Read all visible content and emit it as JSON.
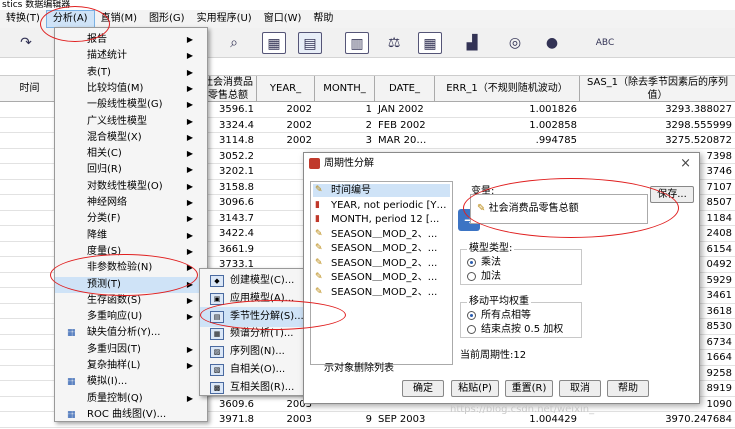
{
  "window": {
    "title": "stics 数据编辑器"
  },
  "menubar": [
    {
      "label": "转换(T)",
      "active": false
    },
    {
      "label": "分析(A)",
      "active": true
    },
    {
      "label": "直销(M)",
      "active": false
    },
    {
      "label": "图形(G)",
      "active": false
    },
    {
      "label": "实用程序(U)",
      "active": false
    },
    {
      "label": "窗口(W)",
      "active": false
    },
    {
      "label": "帮助",
      "active": false
    }
  ],
  "grid": {
    "headers": [
      "时间",
      "社会消费品零售总额",
      "YEAR_",
      "MONTH_",
      "DATE_",
      "ERR_1（不规则随机波动）",
      "SAS_1（除去季节因素后的序列值）"
    ],
    "rows": [
      [
        "",
        "3596.1",
        "2002",
        "1",
        "JAN 2002",
        "1.001826",
        "3293.388027"
      ],
      [
        "",
        "3324.4",
        "2002",
        "2",
        "FEB 2002",
        "1.002858",
        "3298.555999"
      ],
      [
        "",
        "3114.8",
        "2002",
        "3",
        "MAR 20…",
        ".994785",
        "3275.520872"
      ],
      [
        "",
        "3052.2",
        "",
        "",
        "",
        "",
        "7398"
      ],
      [
        "",
        "3202.1",
        "",
        "",
        "",
        "",
        "3746"
      ],
      [
        "",
        "3158.8",
        "",
        "",
        "",
        "",
        "7107"
      ],
      [
        "",
        "3096.6",
        "",
        "",
        "",
        "",
        "8507"
      ],
      [
        "",
        "3143.7",
        "",
        "",
        "",
        "",
        "1184"
      ],
      [
        "",
        "3422.4",
        "",
        "",
        "",
        "",
        "2408"
      ],
      [
        "",
        "3661.9",
        "",
        "",
        "",
        "",
        "6154"
      ],
      [
        "",
        "3733.1",
        "",
        "",
        "",
        "",
        "0492"
      ],
      [
        "",
        "",
        "",
        "",
        "",
        "",
        "5929"
      ],
      [
        "",
        "",
        "",
        "",
        "",
        "",
        "3461"
      ],
      [
        "",
        "",
        "",
        "",
        "",
        "",
        "3618"
      ],
      [
        "",
        "",
        "",
        "",
        "",
        "",
        "8530"
      ],
      [
        "",
        "",
        "",
        "",
        "",
        "",
        "6734"
      ],
      [
        "",
        "",
        "",
        "",
        "",
        "",
        "1664"
      ],
      [
        "",
        "",
        "",
        "",
        "",
        "",
        "9258"
      ],
      [
        "",
        "",
        "",
        "",
        "",
        "",
        "8919"
      ],
      [
        "",
        "3609.6",
        "2003",
        "",
        "",
        "",
        "1090"
      ],
      [
        "",
        "3971.8",
        "2003",
        "9",
        "SEP 2003",
        "1.004429",
        "3970.247684"
      ]
    ]
  },
  "analyze_menu": [
    {
      "label": "报告",
      "submenu": true
    },
    {
      "label": "描述统计",
      "submenu": true
    },
    {
      "label": "表(T)",
      "submenu": true
    },
    {
      "label": "比较均值(M)",
      "submenu": true
    },
    {
      "label": "一般线性模型(G)",
      "submenu": true
    },
    {
      "label": "广义线性模型",
      "submenu": true
    },
    {
      "label": "混合模型(X)",
      "submenu": true
    },
    {
      "label": "相关(C)",
      "submenu": true
    },
    {
      "label": "回归(R)",
      "submenu": true
    },
    {
      "label": "对数线性模型(O)",
      "submenu": true
    },
    {
      "label": "神经网络",
      "submenu": true
    },
    {
      "label": "分类(F)",
      "submenu": true
    },
    {
      "label": "降维",
      "submenu": true
    },
    {
      "label": "度量(S)",
      "submenu": true
    },
    {
      "label": "非参数检验(N)",
      "submenu": true
    },
    {
      "label": "预测(T)",
      "submenu": true,
      "highlight": true
    },
    {
      "label": "生存函数(S)",
      "submenu": true
    },
    {
      "label": "多重响应(U)",
      "submenu": true
    },
    {
      "label": "缺失值分析(Y)...",
      "submenu": false,
      "icon": true
    },
    {
      "label": "多重归因(T)",
      "submenu": true
    },
    {
      "label": "复杂抽样(L)",
      "submenu": true
    },
    {
      "label": "模拟(I)...",
      "submenu": false,
      "icon": true
    },
    {
      "label": "质量控制(Q)",
      "submenu": true
    },
    {
      "label": "ROC 曲线图(V)...",
      "submenu": false,
      "icon": true
    }
  ],
  "forecast_menu": [
    {
      "label": "创建模型(C)...",
      "highlight": false
    },
    {
      "label": "应用模型(A)...",
      "highlight": false
    },
    {
      "label": "季节性分解(S)...",
      "highlight": true
    },
    {
      "label": "频谱分析(T)...",
      "highlight": false
    },
    {
      "label": "序列图(N)...",
      "highlight": false
    },
    {
      "label": "自相关(O)...",
      "highlight": false
    },
    {
      "label": "互相关图(R)...",
      "highlight": false
    }
  ],
  "dialog": {
    "title": "周期性分解",
    "close": "×",
    "source_vars": [
      "时间编号",
      "YEAR, not periodic [Y…",
      "MONTH, period 12 [...",
      "SEASON＿MOD_2、...",
      "SEASON＿MOD_2、...",
      "SEASON＿MOD_2、...",
      "SEASON＿MOD_2、...",
      "SEASON＿MOD_2、..."
    ],
    "variables_label": "变量:",
    "target_var": "社会消费品零售总额",
    "save_button": "保存...",
    "model_type": {
      "title": "模型类型:",
      "options": [
        {
          "label": "乘法",
          "on": true
        },
        {
          "label": "加法",
          "on": false
        }
      ]
    },
    "moving_avg": {
      "title": "移动平均权重",
      "options": [
        {
          "label": "所有点相等",
          "on": true
        },
        {
          "label": "结束点按 0.5 加权",
          "on": false
        }
      ]
    },
    "current_period": "当前周期性:12",
    "display_text": "示对象删除列表",
    "buttons": [
      "确定",
      "粘贴(P)",
      "重置(R)",
      "取消",
      "帮助"
    ]
  },
  "watermark": "https://blog.csdn.net/weixin_"
}
